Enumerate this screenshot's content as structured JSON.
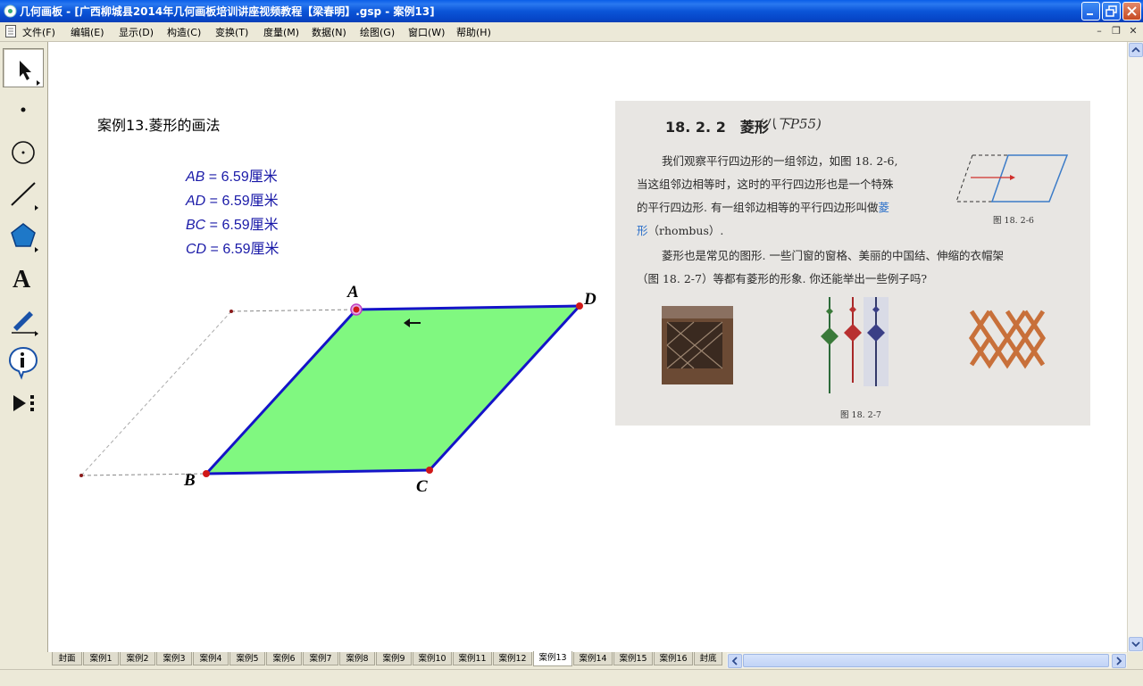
{
  "window": {
    "title": "几何画板 - [广西柳城县2014年几何画板培训讲座视频教程【梁春明】.gsp - 案例13]"
  },
  "menu": {
    "items": [
      "文件(F)",
      "编辑(E)",
      "显示(D)",
      "构造(C)",
      "变换(T)",
      "度量(M)",
      "数据(N)",
      "绘图(G)",
      "窗口(W)",
      "帮助(H)"
    ],
    "mdi_buttons": [
      "–",
      "❐",
      "✕"
    ]
  },
  "toolbox": {
    "tools": [
      "arrow-tool",
      "point-tool",
      "compass-tool",
      "straightedge-tool",
      "polygon-tool",
      "text-tool",
      "marker-tool",
      "information-tool",
      "custom-tool"
    ],
    "text_tool_glyph": "A"
  },
  "canvas": {
    "title": "案例13.菱形的画法",
    "measurements": [
      {
        "label": "AB",
        "value": " = 6.59厘米"
      },
      {
        "label": "AD",
        "value": " = 6.59厘米"
      },
      {
        "label": "BC",
        "value": " = 6.59厘米"
      },
      {
        "label": "CD",
        "value": " = 6.59厘米"
      }
    ],
    "points": {
      "A": "A",
      "B": "B",
      "C": "C",
      "D": "D"
    },
    "colors": {
      "fill": "#80f880",
      "edge": "#1414c8",
      "point": "#d01818",
      "dashed": "#888888"
    }
  },
  "textbook": {
    "heading": "18. 2. 2　菱形",
    "heading_note": "(八下P55)",
    "lines": [
      "我们观察平行四边形的一组邻边，如图 18. 2-6,",
      "当这组邻边相等时，这时的平行四边形也是一个特殊",
      "的平行四边形. 有一组邻边相等的平行四边形叫做"
    ],
    "term_a": "菱",
    "term_b": "形",
    "term_en": "（rhombus）.",
    "para2_1": "菱形也是常见的图形. 一些门窗的窗格、美丽的中国结、伸缩的衣帽架",
    "para2_2": "（图 18. 2-7）等都有菱形的形象. 你还能举出一些例子吗?",
    "fig1_caption": "图 18. 2-6",
    "fig2_caption": "图 18. 2-7"
  },
  "tabs": {
    "items": [
      "封面",
      "案例1",
      "案例2",
      "案例3",
      "案例4",
      "案例5",
      "案例6",
      "案例7",
      "案例8",
      "案例9",
      "案例10",
      "案例11",
      "案例12",
      "案例13",
      "案例14",
      "案例15",
      "案例16",
      "封底"
    ],
    "active": "案例13"
  }
}
